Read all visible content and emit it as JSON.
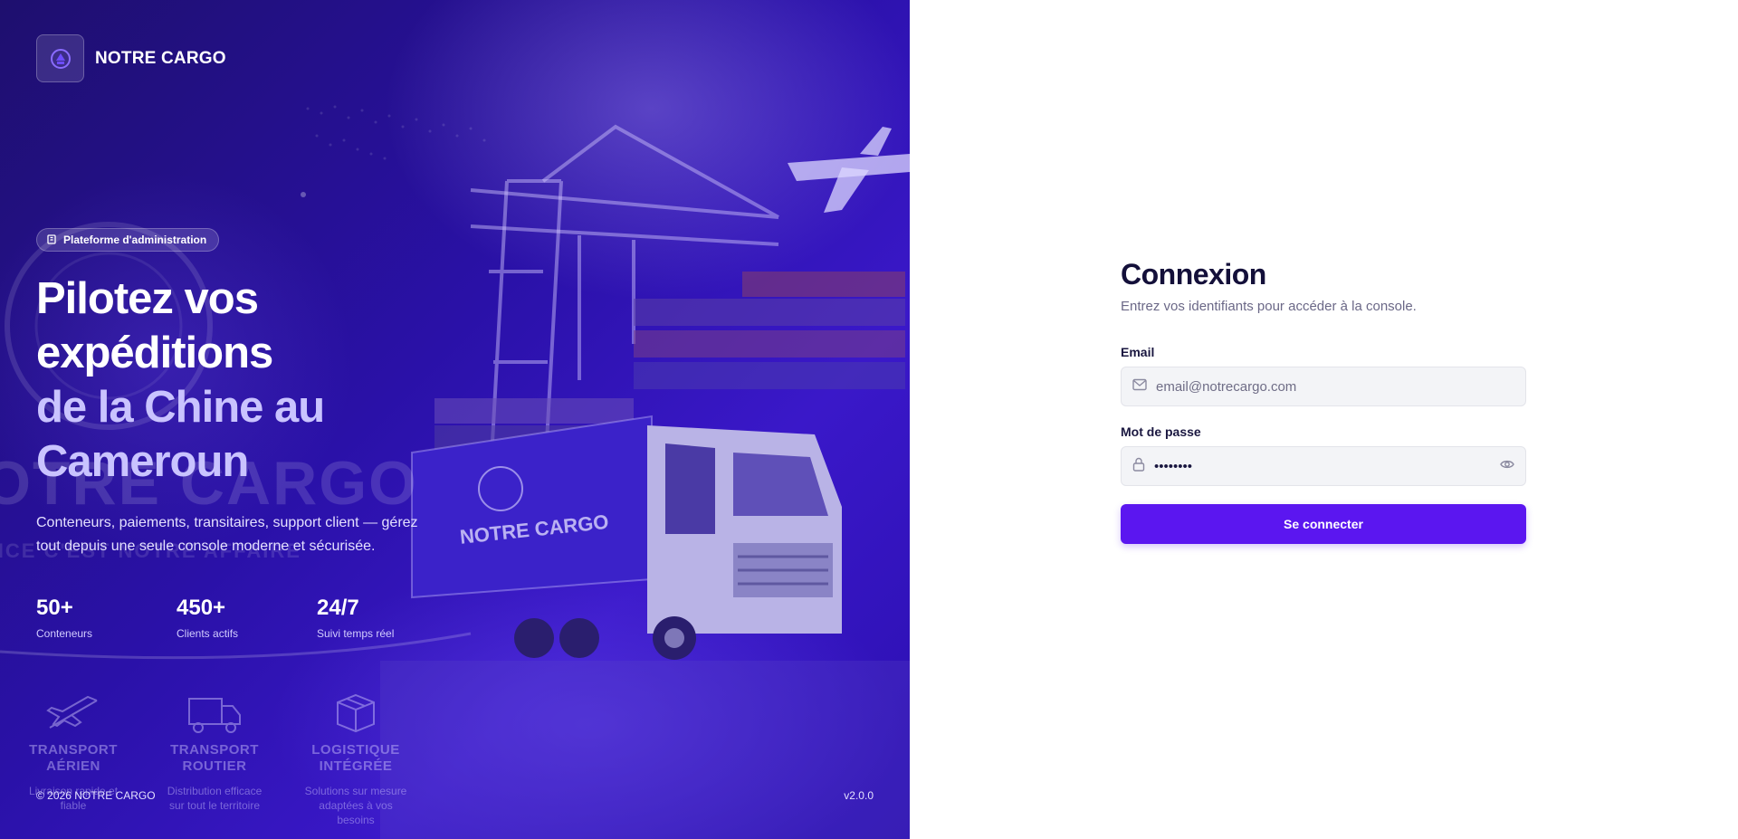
{
  "brand": {
    "name": "NOTRE CARGO"
  },
  "badge": {
    "label": "Plateforme d'administration"
  },
  "headline": {
    "line1": "Pilotez vos",
    "line2": "expéditions",
    "line3": "de la Chine au",
    "line4": "Cameroun"
  },
  "subtitle": "Conteneurs, paiements, transitaires, support client — gérez tout depuis une seule console moderne et sécurisée.",
  "stats": [
    {
      "value": "50+",
      "label": "Conteneurs"
    },
    {
      "value": "450+",
      "label": "Clients actifs"
    },
    {
      "value": "24/7",
      "label": "Suivi temps réel"
    }
  ],
  "services": [
    {
      "title": "TRANSPORT AÉRIEN",
      "desc": "Livraison rapide et fiable",
      "icon": "airplane-icon"
    },
    {
      "title": "TRANSPORT ROUTIER",
      "desc": "Distribution efficace sur tout le territoire",
      "icon": "truck-icon"
    },
    {
      "title": "LOGISTIQUE INTÉGRÉE",
      "desc": "Solutions sur mesure adaptées à vos besoins",
      "icon": "package-icon"
    }
  ],
  "watermark": {
    "text": "NOTRE CARGO",
    "tagline": "LE SERVICE C'EST NOTRE AFFAIRE"
  },
  "footer": {
    "copyright": "© 2026 NOTRE CARGO",
    "version": "v2.0.0"
  },
  "login": {
    "title": "Connexion",
    "subtitle": "Entrez vos identifiants pour accéder à la console.",
    "email_label": "Email",
    "email_placeholder": "email@notrecargo.com",
    "password_label": "Mot de passe",
    "password_value": "••••••••",
    "submit_label": "Se connecter"
  },
  "colors": {
    "hero": "#2a11a8",
    "accent": "#5b16f0",
    "heading": "#14103a"
  }
}
